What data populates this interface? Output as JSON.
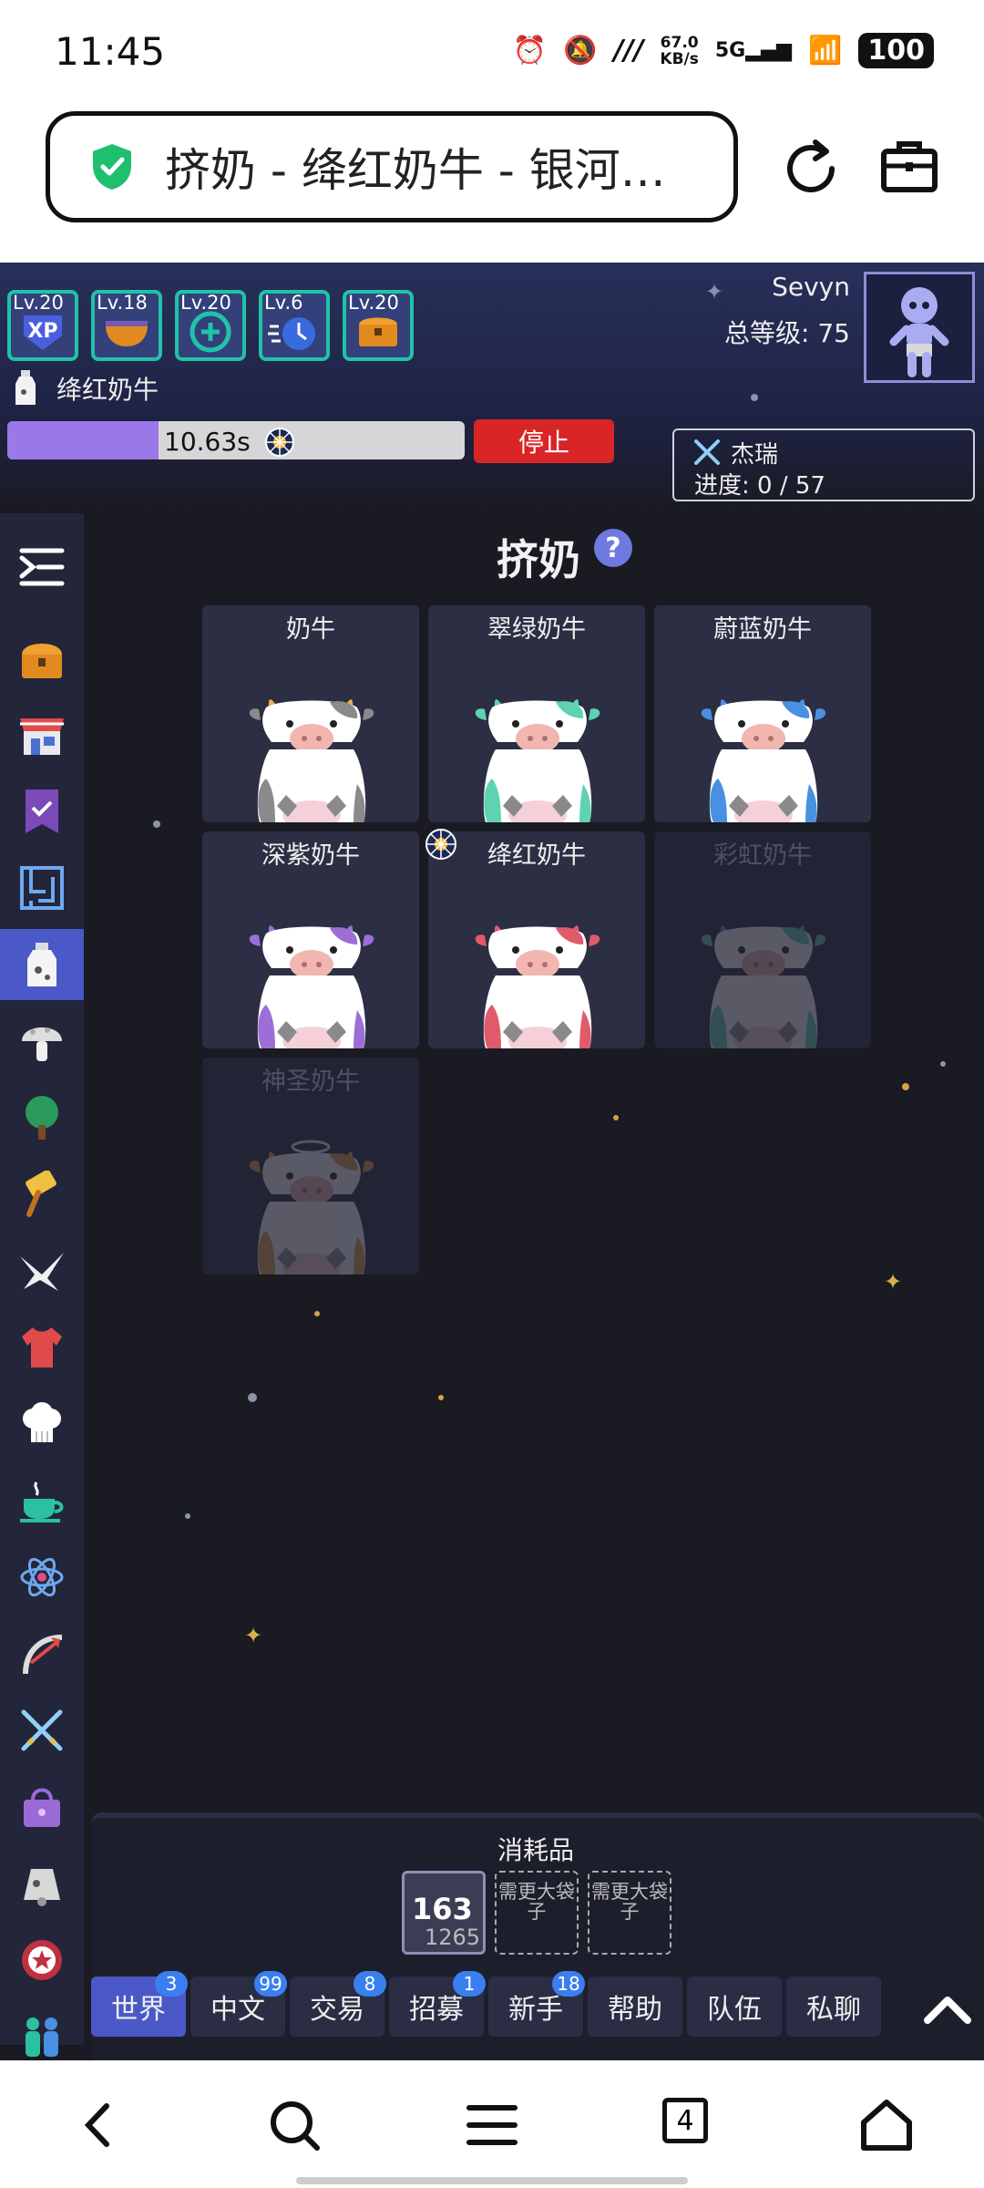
{
  "status_bar": {
    "time": "11:45",
    "net_speed_value": "67.0",
    "net_speed_unit": "KB/s",
    "network": "5G",
    "battery": "100"
  },
  "browser": {
    "url_title": "挤奶 - 绛红奶牛 - 银河…",
    "shield_color": "#1ec06e"
  },
  "header": {
    "skills": [
      {
        "level": "Lv.20",
        "icon": "xp-icon"
      },
      {
        "level": "Lv.18",
        "icon": "bowl-icon"
      },
      {
        "level": "Lv.20",
        "icon": "plus-ring-icon"
      },
      {
        "level": "Lv.6",
        "icon": "clock-speed-icon"
      },
      {
        "level": "Lv.20",
        "icon": "chest-icon"
      }
    ],
    "username": "Sevyn",
    "total_level": "总等级: 75",
    "action_name": "绛红奶牛",
    "progress_time": "10.63s",
    "progress_fraction": 0.33,
    "stop_label": "停止",
    "quest_name": "杰瑞",
    "quest_progress": "进度: 0 / 57"
  },
  "sidebar": {
    "items": [
      {
        "icon": "menu-icon"
      },
      {
        "icon": "chest-icon"
      },
      {
        "icon": "shop-icon"
      },
      {
        "icon": "quest-banner-icon"
      },
      {
        "icon": "maze-icon"
      },
      {
        "icon": "milk-icon",
        "active": true
      },
      {
        "icon": "mushroom-icon"
      },
      {
        "icon": "tree-icon"
      },
      {
        "icon": "cheese-hammer-icon"
      },
      {
        "icon": "paper-crane-icon"
      },
      {
        "icon": "shirt-icon"
      },
      {
        "icon": "chef-hat-icon"
      },
      {
        "icon": "tea-cup-icon"
      },
      {
        "icon": "atom-icon"
      },
      {
        "icon": "ranged-icon"
      },
      {
        "icon": "swords-icon"
      },
      {
        "icon": "bag-icon"
      },
      {
        "icon": "bell-icon"
      },
      {
        "icon": "shield-star-icon"
      },
      {
        "icon": "people-icon"
      }
    ]
  },
  "main": {
    "title": "挤奶",
    "help": "?",
    "cows": [
      {
        "name": "奶牛",
        "spot_color": "#8a8a8a",
        "horn_color": "#f0b040",
        "locked": false
      },
      {
        "name": "翠绿奶牛",
        "spot_color": "#5fd3b0",
        "horn_color": "#5fd3b0",
        "locked": false
      },
      {
        "name": "蔚蓝奶牛",
        "spot_color": "#4a90e2",
        "horn_color": "#4a90e2",
        "locked": false
      },
      {
        "name": "深紫奶牛",
        "spot_color": "#9b6fd6",
        "horn_color": "#9b6fd6",
        "locked": false
      },
      {
        "name": "绛红奶牛",
        "spot_color": "#e05a6a",
        "horn_color": "#e05a6a",
        "locked": false
      },
      {
        "name": "彩虹奶牛",
        "spot_color": "#5fd3b0",
        "horn_color": "#4a90e2",
        "locked": true
      },
      {
        "name": "神圣奶牛",
        "spot_color": "#e0a040",
        "horn_color": "#e0a040",
        "locked": true
      }
    ]
  },
  "consumables": {
    "title": "消耗品",
    "item_count": "163",
    "item_sub": "1265",
    "empty_slot_1": "需更大袋子",
    "empty_slot_2": "需更大袋子"
  },
  "chat": {
    "tabs": [
      {
        "label": "世界",
        "badge": "3",
        "active": true
      },
      {
        "label": "中文",
        "badge": "99"
      },
      {
        "label": "交易",
        "badge": "8"
      },
      {
        "label": "招募",
        "badge": "1"
      },
      {
        "label": "新手",
        "badge": "18"
      },
      {
        "label": "帮助"
      },
      {
        "label": "队伍"
      },
      {
        "label": "私聊"
      }
    ]
  },
  "navbar": {
    "tab_count": "4"
  }
}
